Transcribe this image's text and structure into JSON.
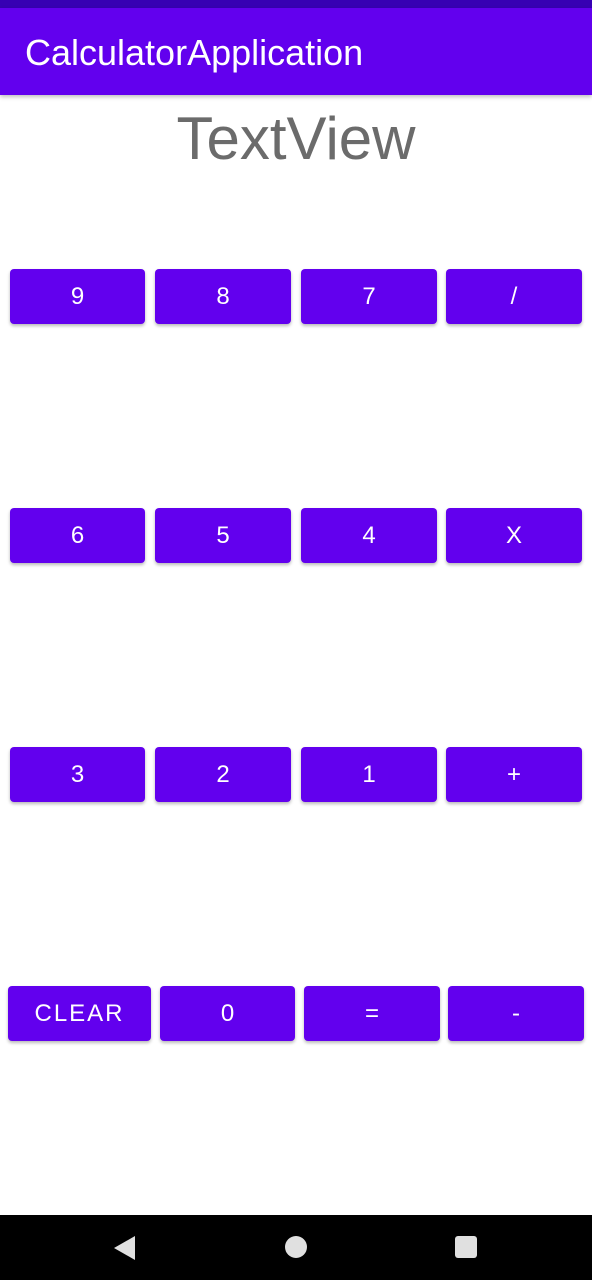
{
  "app": {
    "title": "CalculatorApplication"
  },
  "display": {
    "text": "TextView"
  },
  "keypad": {
    "row1": [
      "9",
      "8",
      "7",
      "/"
    ],
    "row2": [
      "6",
      "5",
      "4",
      "X"
    ],
    "row3": [
      "3",
      "2",
      "1",
      "+"
    ],
    "row4": [
      "CLEAR",
      "0",
      "=",
      "-"
    ]
  },
  "navbar": {
    "icons": [
      "back-icon",
      "home-icon",
      "recents-icon"
    ]
  },
  "colors": {
    "primary": "#6200ee",
    "primary_dark": "#3700b3",
    "display_text": "#6b6b6b",
    "navbar": "#000000"
  }
}
